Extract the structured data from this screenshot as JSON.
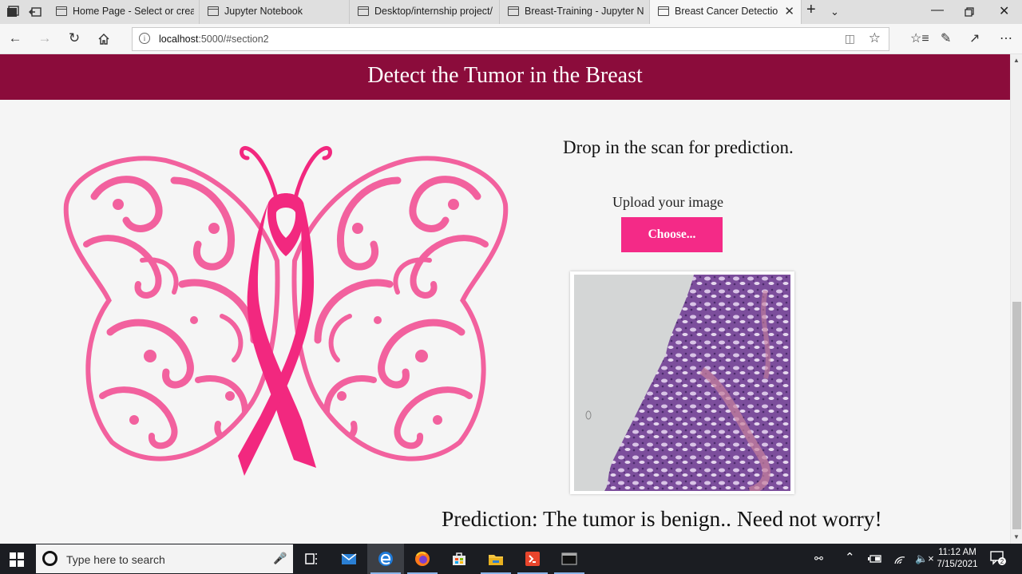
{
  "browser": {
    "tabs": [
      {
        "label": "Home Page - Select or creat",
        "active": false
      },
      {
        "label": "Jupyter Notebook",
        "active": false
      },
      {
        "label": "Desktop/internship project/",
        "active": false
      },
      {
        "label": "Breast-Training - Jupyter Nc",
        "active": false
      },
      {
        "label": "Breast Cancer Detectior",
        "active": true
      }
    ],
    "address": {
      "host": "localhost",
      "rest": ":5000/#section2"
    }
  },
  "page": {
    "banner_title": "Detect the Tumor in the Breast",
    "heading": "Drop in the scan for prediction.",
    "upload_label": "Upload your image",
    "choose_button": "Choose...",
    "prediction": "Prediction: The tumor is benign.. Need not worry!"
  },
  "taskbar": {
    "search_placeholder": "Type here to search",
    "clock_time": "11:12 AM",
    "clock_date": "7/15/2021",
    "notification_count": "2"
  },
  "colors": {
    "banner": "#8b0c3b",
    "accent_pink": "#f42a87",
    "butterfly_pink": "#f2619e",
    "ribbon_pink": "#f2287f"
  },
  "icons": [
    "window-menu-icon",
    "back-tabs-icon",
    "new-tab-icon",
    "tab-list-icon",
    "back-icon",
    "forward-icon",
    "refresh-icon",
    "home-icon",
    "info-icon",
    "reading-view-icon",
    "favorite-star-icon",
    "favorites-bar-icon",
    "pen-icon",
    "share-icon",
    "more-icon",
    "windows-start-icon",
    "cortana-icon",
    "microphone-icon",
    "task-view-icon",
    "mail-icon",
    "edge-icon",
    "firefox-icon",
    "store-icon",
    "file-explorer-icon",
    "app-icon",
    "terminal-icon",
    "people-icon",
    "network-icon",
    "volume-icon",
    "notification-icon"
  ]
}
